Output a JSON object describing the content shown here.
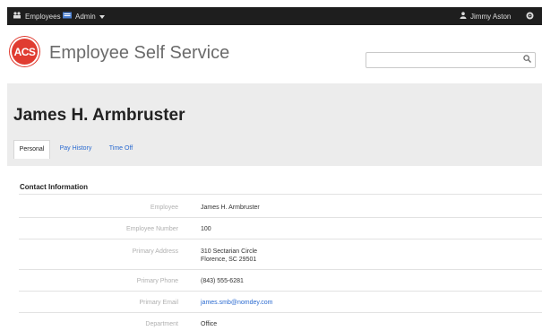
{
  "topbar": {
    "employees_label": "Employees",
    "admin_label": "Admin",
    "user_label": "Jimmy Aston"
  },
  "header": {
    "logo_text": "ACS",
    "app_title": "Employee Self Service",
    "search_placeholder": ""
  },
  "employee": {
    "name": "James H. Armbruster"
  },
  "tabs": [
    {
      "label": "Personal"
    },
    {
      "label": "Pay History"
    },
    {
      "label": "Time Off"
    }
  ],
  "section": {
    "title": "Contact Information"
  },
  "contact": [
    {
      "label": "Employee",
      "value": "James H. Armbruster"
    },
    {
      "label": "Employee Number",
      "value": "100"
    },
    {
      "label": "Primary Address",
      "value_line1": "310 Sectarian Circle",
      "value_line2": "Florence, SC 29501"
    },
    {
      "label": "Primary Phone",
      "value": "(843) 555-6281"
    },
    {
      "label": "Primary Email",
      "value": "james.smb@nomdey.com"
    },
    {
      "label": "Department",
      "value": "Office"
    }
  ],
  "colors": {
    "topbar": "#1e1e1e",
    "accent_link": "#2a6ad0",
    "logo_red": "#e03c31",
    "band": "#ececec"
  },
  "icons": [
    "employees-icon",
    "admin-icon",
    "caret-down-icon",
    "user-icon",
    "gear-icon",
    "search-icon"
  ]
}
